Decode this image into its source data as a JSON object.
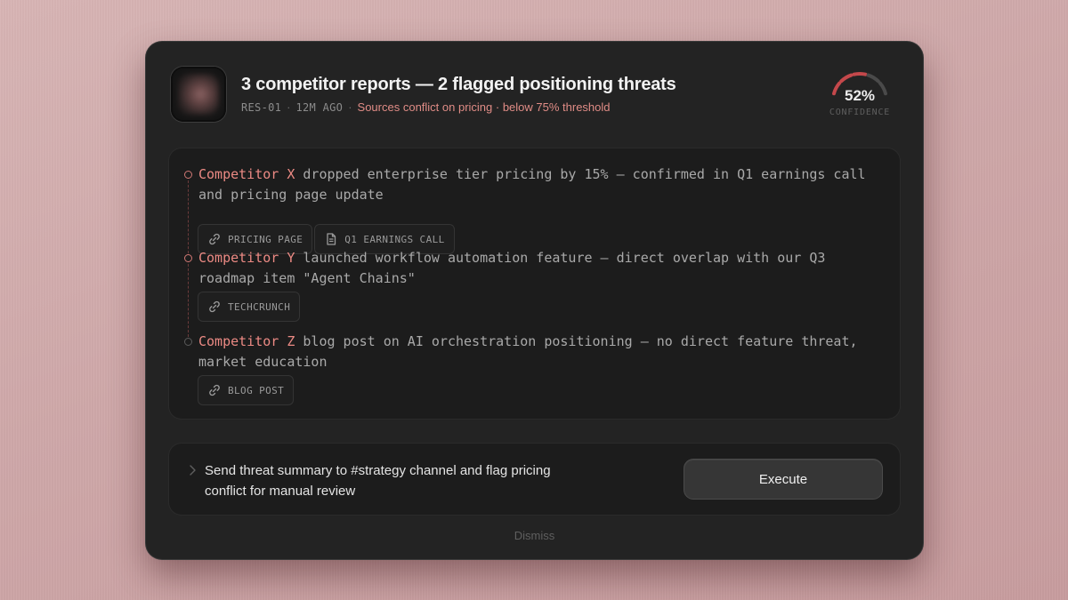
{
  "header": {
    "title": "3 competitor reports — 2 flagged positioning threats",
    "agent_id": "RES-01",
    "time_ago": "12M AGO",
    "warning": "Sources conflict on pricing · below 75% threshold",
    "separator": "·"
  },
  "confidence": {
    "value_text": "52%",
    "value": 52,
    "label": "CONFIDENCE",
    "segments_total": 5,
    "segments_filled": 3
  },
  "findings": [
    {
      "company": "Competitor X",
      "text": " dropped enterprise tier pricing by 15% — confirmed in Q1 earnings call and pricing page update",
      "sources": [
        {
          "label": "PRICING PAGE",
          "icon": "link-icon"
        },
        {
          "label": "Q1 EARNINGS CALL",
          "icon": "document-icon"
        }
      ]
    },
    {
      "company": "Competitor Y",
      "text": " launched workflow automation feature — direct overlap with our Q3 roadmap item \"Agent Chains\"",
      "sources": [
        {
          "label": "TECHCRUNCH",
          "icon": "link-icon"
        }
      ]
    },
    {
      "company": "Competitor Z",
      "text": " blog post on AI orchestration positioning — no direct feature threat, market education",
      "sources": [
        {
          "label": "BLOG POST",
          "icon": "link-icon"
        }
      ]
    }
  ],
  "action": {
    "text": "Send threat summary to #strategy channel and flag pricing conflict for manual review",
    "execute_label": "Execute"
  },
  "dismiss_label": "Dismiss",
  "colors": {
    "accent": "#ec8a84",
    "warning": "#e08c86",
    "gauge_filled": "#c4484b",
    "gauge_empty": "#4a4a4a"
  }
}
